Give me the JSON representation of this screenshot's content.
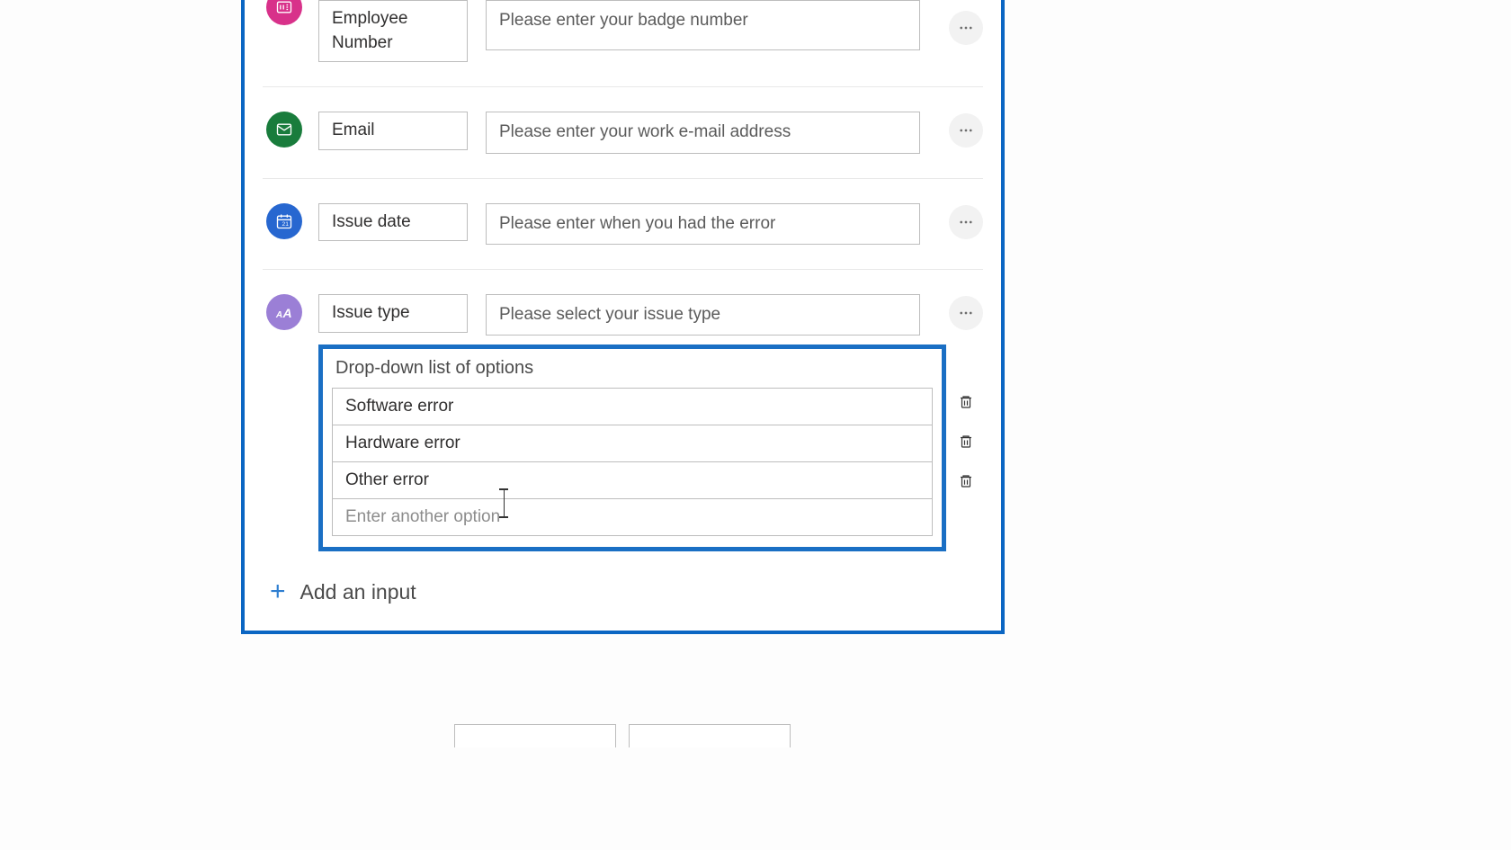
{
  "inputs": {
    "employee_number": {
      "label": "Employee Number",
      "prompt": "Please enter your badge number",
      "icon": "number"
    },
    "email": {
      "label": "Email",
      "prompt": "Please enter your work e-mail address",
      "icon": "email"
    },
    "issue_date": {
      "label": "Issue date",
      "prompt": "Please enter when you had the error",
      "icon": "date"
    },
    "issue_type": {
      "label": "Issue type",
      "prompt": "Please select your issue type",
      "icon": "text"
    }
  },
  "dropdown": {
    "title": "Drop-down list of options",
    "options": {
      "o1": "Software error",
      "o2": "Hardware error",
      "o3": "Other error"
    },
    "new_option_placeholder": "Enter another option"
  },
  "actions": {
    "add_input": "Add an input"
  }
}
